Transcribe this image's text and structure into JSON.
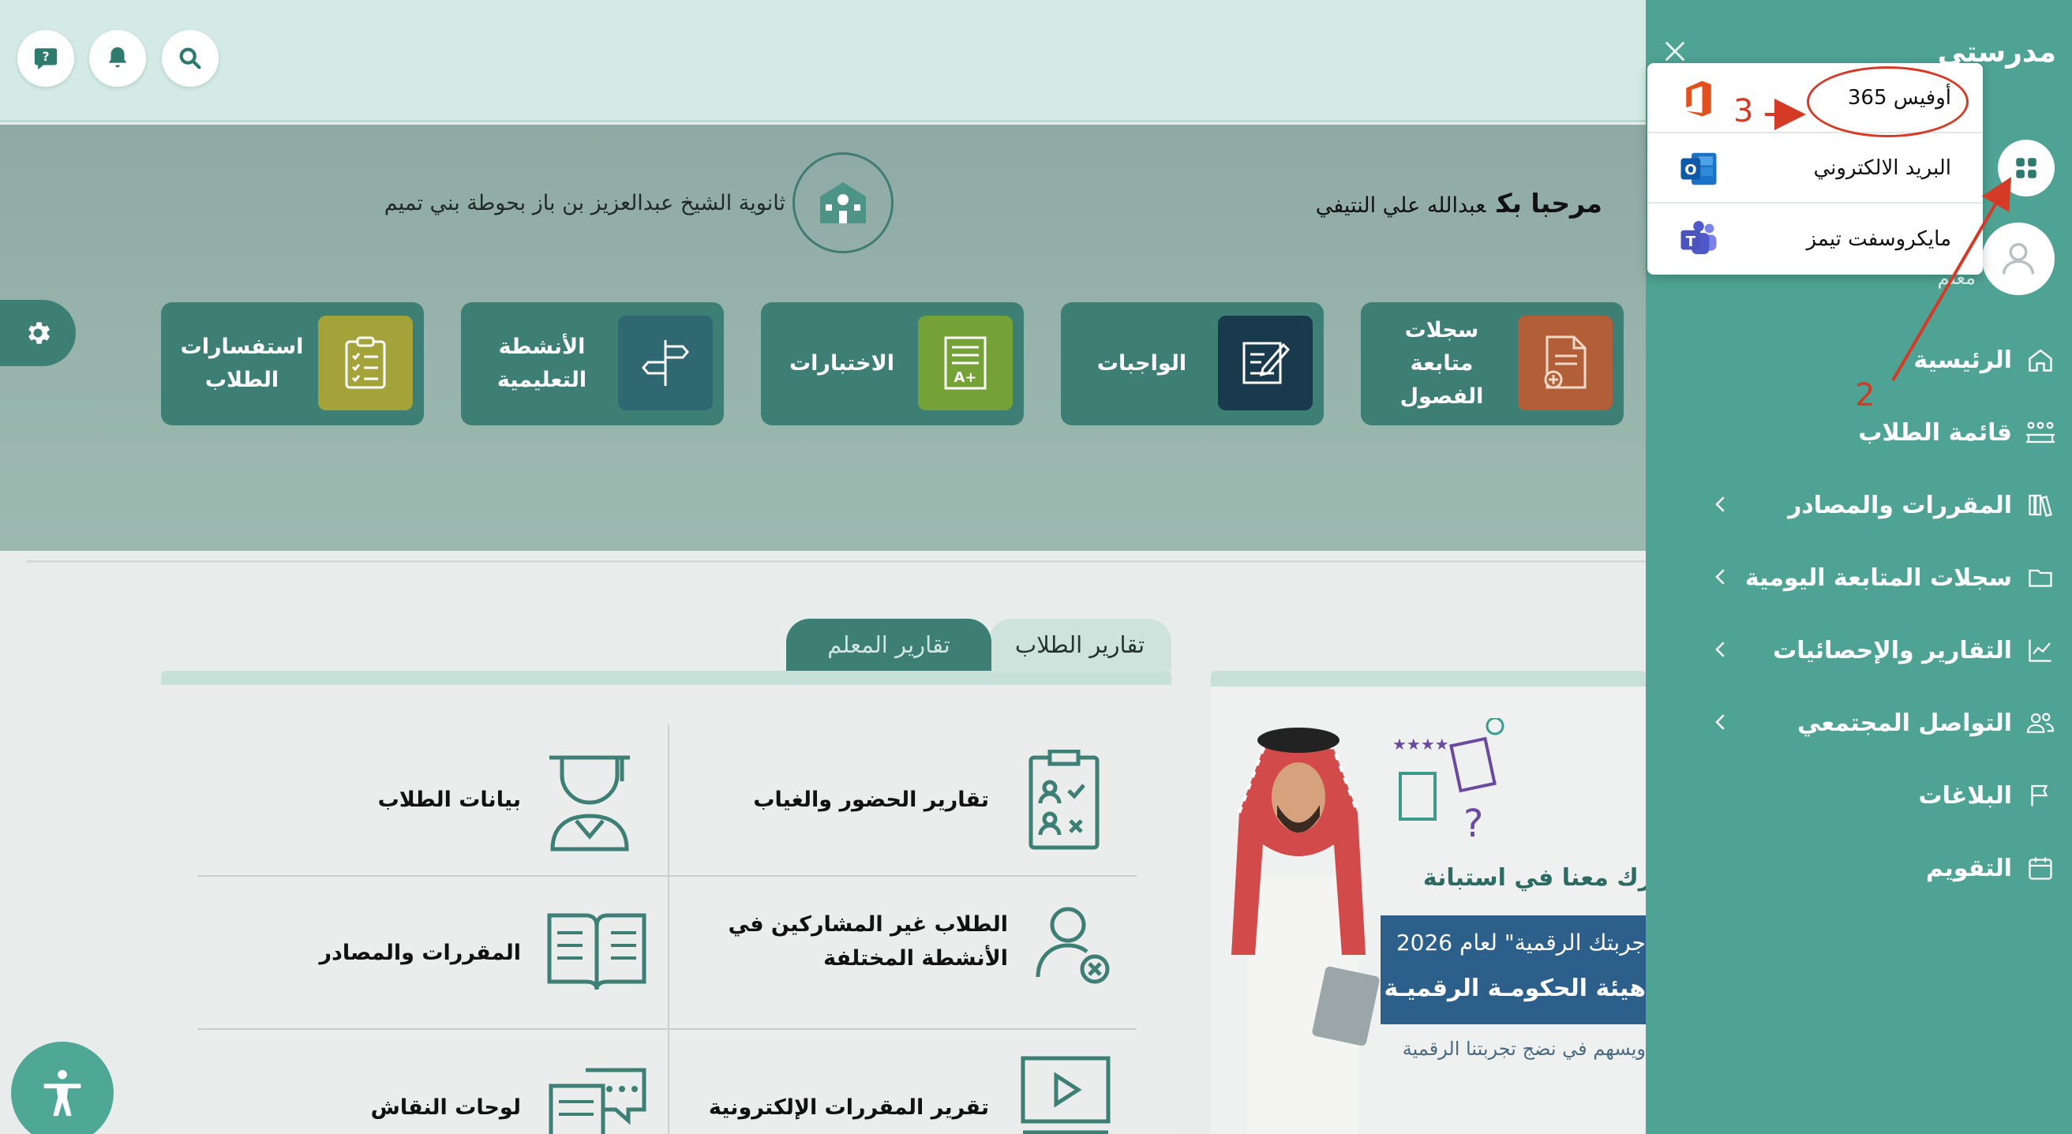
{
  "topbar": {
    "buttons": [
      "search-icon",
      "bell-icon",
      "help-chat-icon"
    ]
  },
  "hero": {
    "school_name": "ثانوية الشيخ عبدالعزيز بن باز بحوطة بني تميم",
    "welcome": "مرحبا بك",
    "user_name": "عبدالله علي النتيفي",
    "cards": [
      {
        "label": "سجلات متابعة الفصول",
        "icon": "document-plus-icon",
        "color": "#b25f38"
      },
      {
        "label": "الواجبات",
        "icon": "pen-document-icon",
        "color": "#193a4c"
      },
      {
        "label": "الاختبارات",
        "icon": "exam-aplus-icon",
        "color": "#74a236"
      },
      {
        "label": "الأنشطة التعليمية",
        "icon": "signpost-icon",
        "color": "#2f6870"
      },
      {
        "label": "استفسارات الطلاب",
        "icon": "clipboard-list-icon",
        "color": "#a3a33a"
      }
    ]
  },
  "tabs": {
    "students": "تقارير الطلاب",
    "teacher": "تقارير المعلم"
  },
  "reports": [
    "تقارير الحضور والغياب",
    "بيانات الطلاب",
    "الطلاب غير المشاركين في الأنشطة المختلفة",
    "المقررات والمصادر",
    "تقرير المقررات الإلكترونية",
    "لوحات النقاش"
  ],
  "banner": {
    "title": "رك معنا في استبانة",
    "line1": "جربتك الرقمية\" لعام 2026",
    "line2": "هيئة الحكومـة الرقميـة",
    "line3": "ويسهم في نضج تجربتنا الرقمية"
  },
  "sidebar": {
    "brand": "مدرستي",
    "role": "معلم",
    "menu": [
      {
        "label": "الرئيسية",
        "icon": "home-icon",
        "chevron": false
      },
      {
        "label": "قائمة الطلاب",
        "icon": "students-icon",
        "chevron": false
      },
      {
        "label": "المقررات والمصادر",
        "icon": "books-icon",
        "chevron": true
      },
      {
        "label": "سجلات المتابعة اليومية",
        "icon": "folder-icon",
        "chevron": true
      },
      {
        "label": "التقارير والإحصائيات",
        "icon": "chart-icon",
        "chevron": true
      },
      {
        "label": "التواصل المجتمعي",
        "icon": "users-icon",
        "chevron": true
      },
      {
        "label": "البلاغات",
        "icon": "flag-icon",
        "chevron": false
      },
      {
        "label": "التقويم",
        "icon": "calendar-icon",
        "chevron": false
      }
    ]
  },
  "apps_dropdown": {
    "items": [
      {
        "label": "أوفيس 365",
        "icon": "office-icon"
      },
      {
        "label": "البريد الالكتروني",
        "icon": "outlook-icon"
      },
      {
        "label": "مايكروسفت تيمز",
        "icon": "teams-icon"
      }
    ]
  },
  "annotations": {
    "step2": "2",
    "step3": "3",
    "color": "#d43a25"
  }
}
